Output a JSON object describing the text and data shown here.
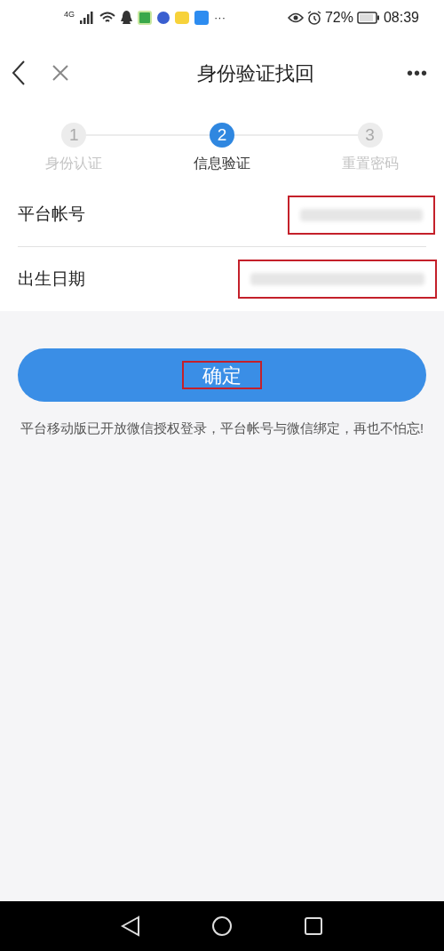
{
  "status_bar": {
    "network": "4G",
    "more": "···",
    "battery": "72%",
    "time": "08:39"
  },
  "header": {
    "title": "身份验证找回",
    "more": "•••"
  },
  "steps": [
    {
      "number": "1",
      "label": "身份认证",
      "selected": false
    },
    {
      "number": "2",
      "label": "信息验证",
      "selected": true
    },
    {
      "number": "3",
      "label": "重置密码",
      "selected": false
    }
  ],
  "fields": [
    {
      "label": "平台帐号",
      "highlighted": true
    },
    {
      "label": "出生日期",
      "highlighted": true
    }
  ],
  "confirm_button": {
    "label": "确定",
    "highlighted": true
  },
  "note": "平台移动版已开放微信授权登录，平台帐号与微信绑定，再也不怕忘!"
}
